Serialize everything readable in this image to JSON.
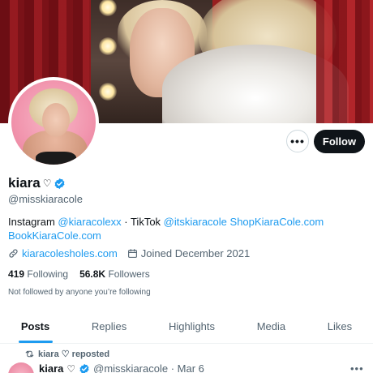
{
  "profile": {
    "display_name": "kiara",
    "name_heart": "♡",
    "handle": "@misskiaracole",
    "bio": {
      "line1_prefix": "Instagram ",
      "instagram_link": "@kiaracolexx",
      "line1_sep": " · TikTok ",
      "tiktok_link": "@itskiaracole",
      "shop_link": "ShopKiaraCole.com",
      "book_link": "BookKiaraCole.com"
    },
    "website": "kiaracolesholes.com",
    "joined": "Joined December 2021",
    "following_count": "419",
    "following_label": "Following",
    "followers_count": "56.8K",
    "followers_label": "Followers",
    "not_followed_text": "Not followed by anyone you’re following"
  },
  "actions": {
    "more_label": "•••",
    "follow_label": "Follow"
  },
  "tabs": [
    {
      "label": "Posts",
      "active": true
    },
    {
      "label": "Replies",
      "active": false
    },
    {
      "label": "Highlights",
      "active": false
    },
    {
      "label": "Media",
      "active": false
    },
    {
      "label": "Likes",
      "active": false
    }
  ],
  "post": {
    "repost_text": "kiara ♡ reposted",
    "author_name": "kiara",
    "author_heart": "♡",
    "author_handle_date": "@misskiaracole · Mar 6",
    "more": "•••"
  },
  "colors": {
    "accent": "#1d9bf0",
    "text": "#0f1419",
    "muted": "#536471",
    "follow_bg": "#0f1419"
  },
  "icons": [
    "verified-badge-icon",
    "link-icon",
    "calendar-icon",
    "repost-icon",
    "more-icon"
  ]
}
